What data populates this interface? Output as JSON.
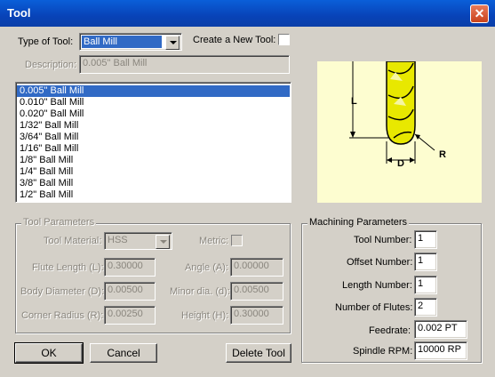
{
  "window": {
    "title": "Tool",
    "close_glyph": "✕"
  },
  "type_of_tool": {
    "label": "Type of Tool:",
    "value": "Ball Mill"
  },
  "create_new_tool": {
    "label": "Create a New Tool:",
    "checked": false
  },
  "description": {
    "label": "Description:",
    "value": "0.005\" Ball Mill"
  },
  "tool_list": {
    "items": [
      "0.005\" Ball Mill",
      "0.010\" Ball Mill",
      "0.020\" Ball Mill",
      "1/32\" Ball Mill",
      "3/64\" Ball Mill",
      "1/16\" Ball Mill",
      "1/8\" Ball Mill",
      "1/4\" Ball Mill",
      "3/8\" Ball Mill",
      "1/2\" Ball Mill"
    ],
    "selected_index": 0
  },
  "diagram": {
    "label_l": "L",
    "label_d": "D",
    "label_r": "R"
  },
  "tool_parameters": {
    "title": "Tool Parameters",
    "tool_material_label": "Tool Material:",
    "tool_material_value": "HSS",
    "metric_label": "Metric:",
    "flute_length_label": "Flute Length (L):",
    "flute_length_value": "0.30000",
    "angle_label": "Angle (A):",
    "angle_value": "0.00000",
    "body_diameter_label": "Body Diameter (D):",
    "body_diameter_value": "0.00500",
    "minor_dia_label": "Minor dia. (d):",
    "minor_dia_value": "0.00500",
    "corner_radius_label": "Corner Radius (R):",
    "corner_radius_value": "0.00250",
    "height_label": "Height (H):",
    "height_value": "0.30000"
  },
  "machining_parameters": {
    "title": "Machining Parameters",
    "tool_number_label": "Tool Number:",
    "tool_number_value": "1",
    "offset_number_label": "Offset Number:",
    "offset_number_value": "1",
    "length_number_label": "Length Number:",
    "length_number_value": "1",
    "number_of_flutes_label": "Number of Flutes:",
    "number_of_flutes_value": "2",
    "feedrate_label": "Feedrate:",
    "feedrate_value": "0.002 PT",
    "spindle_rpm_label": "Spindle RPM:",
    "spindle_rpm_value": "10000 RP"
  },
  "buttons": {
    "ok": "OK",
    "cancel": "Cancel",
    "delete_tool": "Delete Tool"
  },
  "colors": {
    "titlebar": "#0843b8",
    "selection": "#316ac5",
    "diagram_bg": "#fdfdd0",
    "tool_yellow": "#e8e800"
  }
}
